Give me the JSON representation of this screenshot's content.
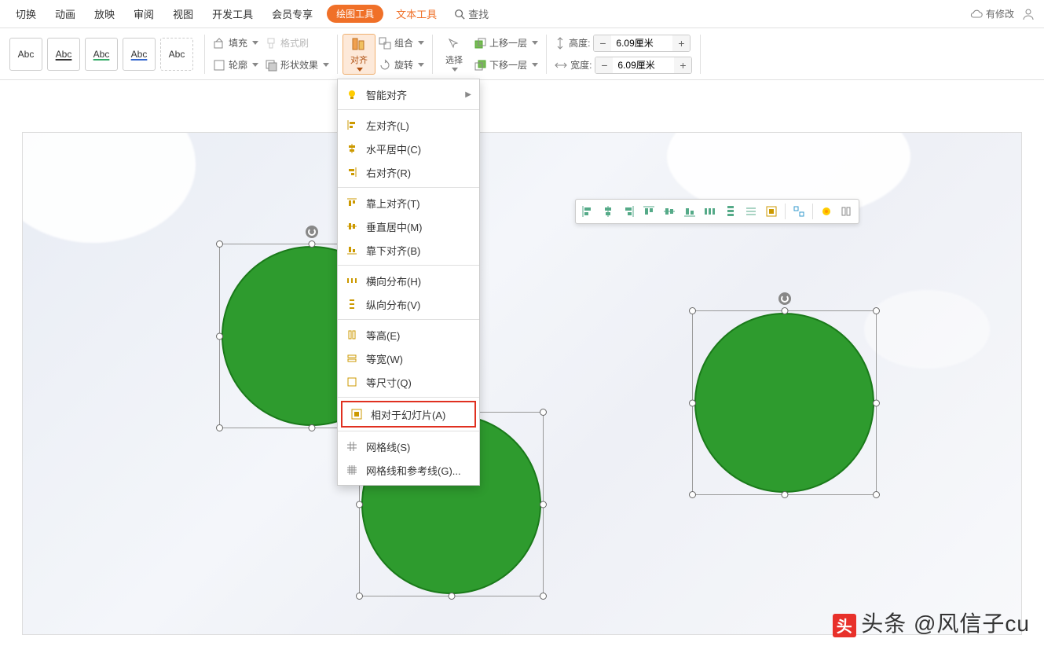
{
  "menubar": {
    "items": [
      "切换",
      "动画",
      "放映",
      "审阅",
      "视图",
      "开发工具",
      "会员专享"
    ],
    "drawing_tool": "绘图工具",
    "text_tool": "文本工具",
    "search": "查找",
    "status": "有修改"
  },
  "abc": [
    "Abc",
    "Abc",
    "Abc",
    "Abc",
    "Abc"
  ],
  "ribbon": {
    "fill": "填充",
    "format_painter": "格式刷",
    "outline": "轮廓",
    "shape_fx": "形状效果",
    "align": "对齐",
    "group": "组合",
    "rotate": "旋转",
    "select": "选择",
    "move_up": "上移一层",
    "move_down": "下移一层",
    "height_label": "高度:",
    "width_label": "宽度:",
    "height_val": "6.09厘米",
    "width_val": "6.09厘米"
  },
  "dropdown": {
    "smart": "智能对齐",
    "left": "左对齐(L)",
    "hcenter": "水平居中(C)",
    "right": "右对齐(R)",
    "top": "靠上对齐(T)",
    "vcenter": "垂直居中(M)",
    "bottom": "靠下对齐(B)",
    "hdist": "横向分布(H)",
    "vdist": "纵向分布(V)",
    "eqh": "等高(E)",
    "eqw": "等宽(W)",
    "eqsize": "等尺寸(Q)",
    "relslide": "相对于幻灯片(A)",
    "grid": "网格线(S)",
    "gridguides": "网格线和参考线(G)..."
  },
  "watermark": "头条 @风信子cu"
}
